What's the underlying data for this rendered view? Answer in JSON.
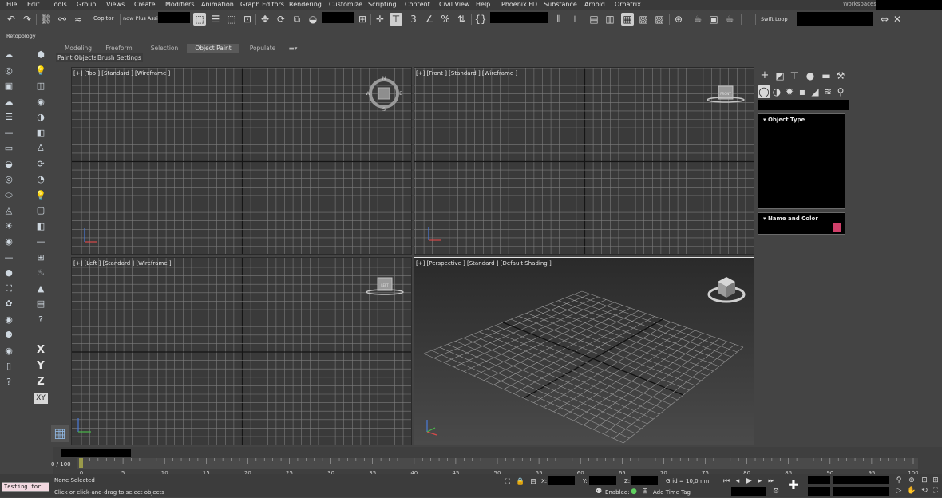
{
  "menu": {
    "items": [
      "File",
      "Edit",
      "Tools",
      "Group",
      "Views",
      "Create",
      "Modifiers",
      "Animation",
      "Graph Editors",
      "Rendering",
      "Customize",
      "Scripting",
      "Content",
      "Civil View",
      "Help",
      "Phoenix FD",
      "Substance",
      "Arnold",
      "Ornatrix"
    ],
    "workspaces_label": "Workspaces:"
  },
  "toolbar": {
    "copitor_label": "Copitor",
    "selection_set_field": "now Plus Assi",
    "swift_loop_label": "Swift Loop",
    "retopology_label": "Retopology"
  },
  "ribbon": {
    "tabs": [
      "Modeling",
      "Freeform",
      "Selection",
      "Object Paint",
      "Populate"
    ],
    "active_tab": "Object Paint",
    "subtabs": [
      "Paint Objects",
      "Brush Settings"
    ]
  },
  "viewports": {
    "top": {
      "label": "[+] [Top ] [Standard ] [Wireframe ]"
    },
    "front": {
      "label": "[+] [Front ] [Standard ] [Wireframe ]"
    },
    "left": {
      "label": "[+] [Left ] [Standard ] [Wireframe ]"
    },
    "perspective": {
      "label": "[+] [Perspective ] [Standard ] [Default Shading ]"
    },
    "compass_letters": {
      "n": "N",
      "s": "S",
      "e": "E",
      "w": "W"
    },
    "viewcube_front": "FRONT",
    "viewcube_left": "LEFT"
  },
  "command_panel": {
    "object_type_label": "Object Type",
    "name_color_label": "Name and Color",
    "object_color": "#d0406a"
  },
  "timeline": {
    "frame_counter": "0 / 100",
    "ticks": [
      "0",
      "5",
      "10",
      "15",
      "20",
      "25",
      "30",
      "35",
      "40",
      "45",
      "50",
      "55",
      "60",
      "65",
      "70",
      "75",
      "80",
      "85",
      "90",
      "95",
      "100"
    ]
  },
  "status": {
    "none_selected": "None Selected",
    "prompt": "Click or click-and-drag to select objects",
    "testing_field": "Testing for",
    "x_label": "X:",
    "y_label": "Y:",
    "z_label": "Z:",
    "grid": "Grid = 10,0mm",
    "enabled_label": "Enabled:",
    "add_time_tag": "Add Time Tag"
  },
  "lefttools": {
    "x_axis": "X",
    "y_axis": "Y",
    "z_axis": "Z",
    "xy_plane": "XY"
  }
}
